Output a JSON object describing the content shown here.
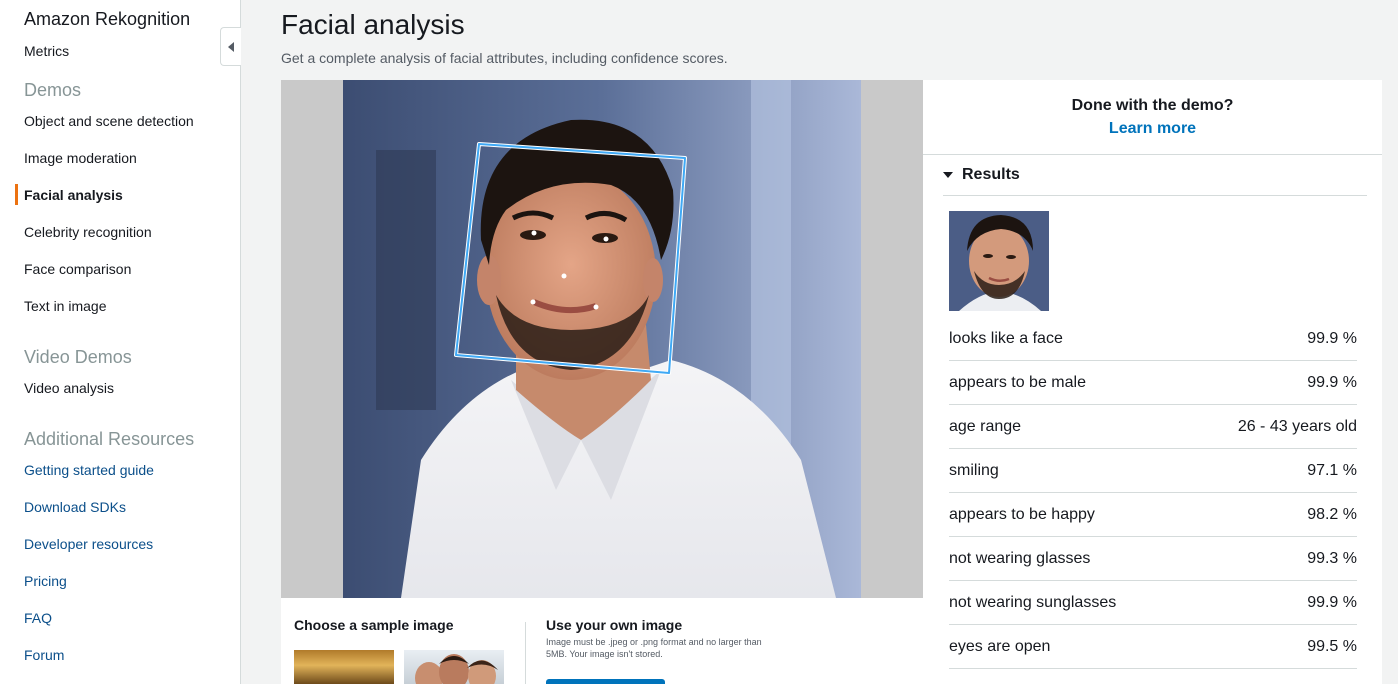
{
  "sidebar": {
    "title": "Amazon Rekognition",
    "metrics": "Metrics",
    "demos_heading": "Demos",
    "demos": [
      "Object and scene detection",
      "Image moderation",
      "Facial analysis",
      "Celebrity recognition",
      "Face comparison",
      "Text in image"
    ],
    "active_demo": "Facial analysis",
    "video_heading": "Video Demos",
    "video_items": [
      "Video analysis"
    ],
    "resources_heading": "Additional Resources",
    "resources": [
      "Getting started guide",
      "Download SDKs",
      "Developer resources",
      "Pricing",
      "FAQ",
      "Forum"
    ]
  },
  "main": {
    "title": "Facial analysis",
    "subtitle": "Get a complete analysis of facial attributes, including confidence scores.",
    "sample_title": "Choose a sample image",
    "own_title": "Use your own image",
    "own_note": "Image must be .jpeg or .png format and no larger than 5MB. Your image isn't stored."
  },
  "results": {
    "done_text": "Done with the demo?",
    "learn_more": "Learn more",
    "header": "Results",
    "attributes": [
      {
        "label": "looks like a face",
        "value": "99.9 %"
      },
      {
        "label": "appears to be male",
        "value": "99.9 %"
      },
      {
        "label": "age range",
        "value": "26 - 43 years old"
      },
      {
        "label": "smiling",
        "value": "97.1 %"
      },
      {
        "label": "appears to be happy",
        "value": "98.2 %"
      },
      {
        "label": "not wearing glasses",
        "value": "99.3 %"
      },
      {
        "label": "not wearing sunglasses",
        "value": "99.9 %"
      },
      {
        "label": "eyes are open",
        "value": "99.5 %"
      }
    ]
  },
  "colors": {
    "accent": "#ec7211",
    "link": "#0b4f8a",
    "primary_button": "#0073bb",
    "bounding_box": "#3fa9f5"
  },
  "icons": [
    "collapse-sidebar-icon",
    "results-caret-icon"
  ]
}
